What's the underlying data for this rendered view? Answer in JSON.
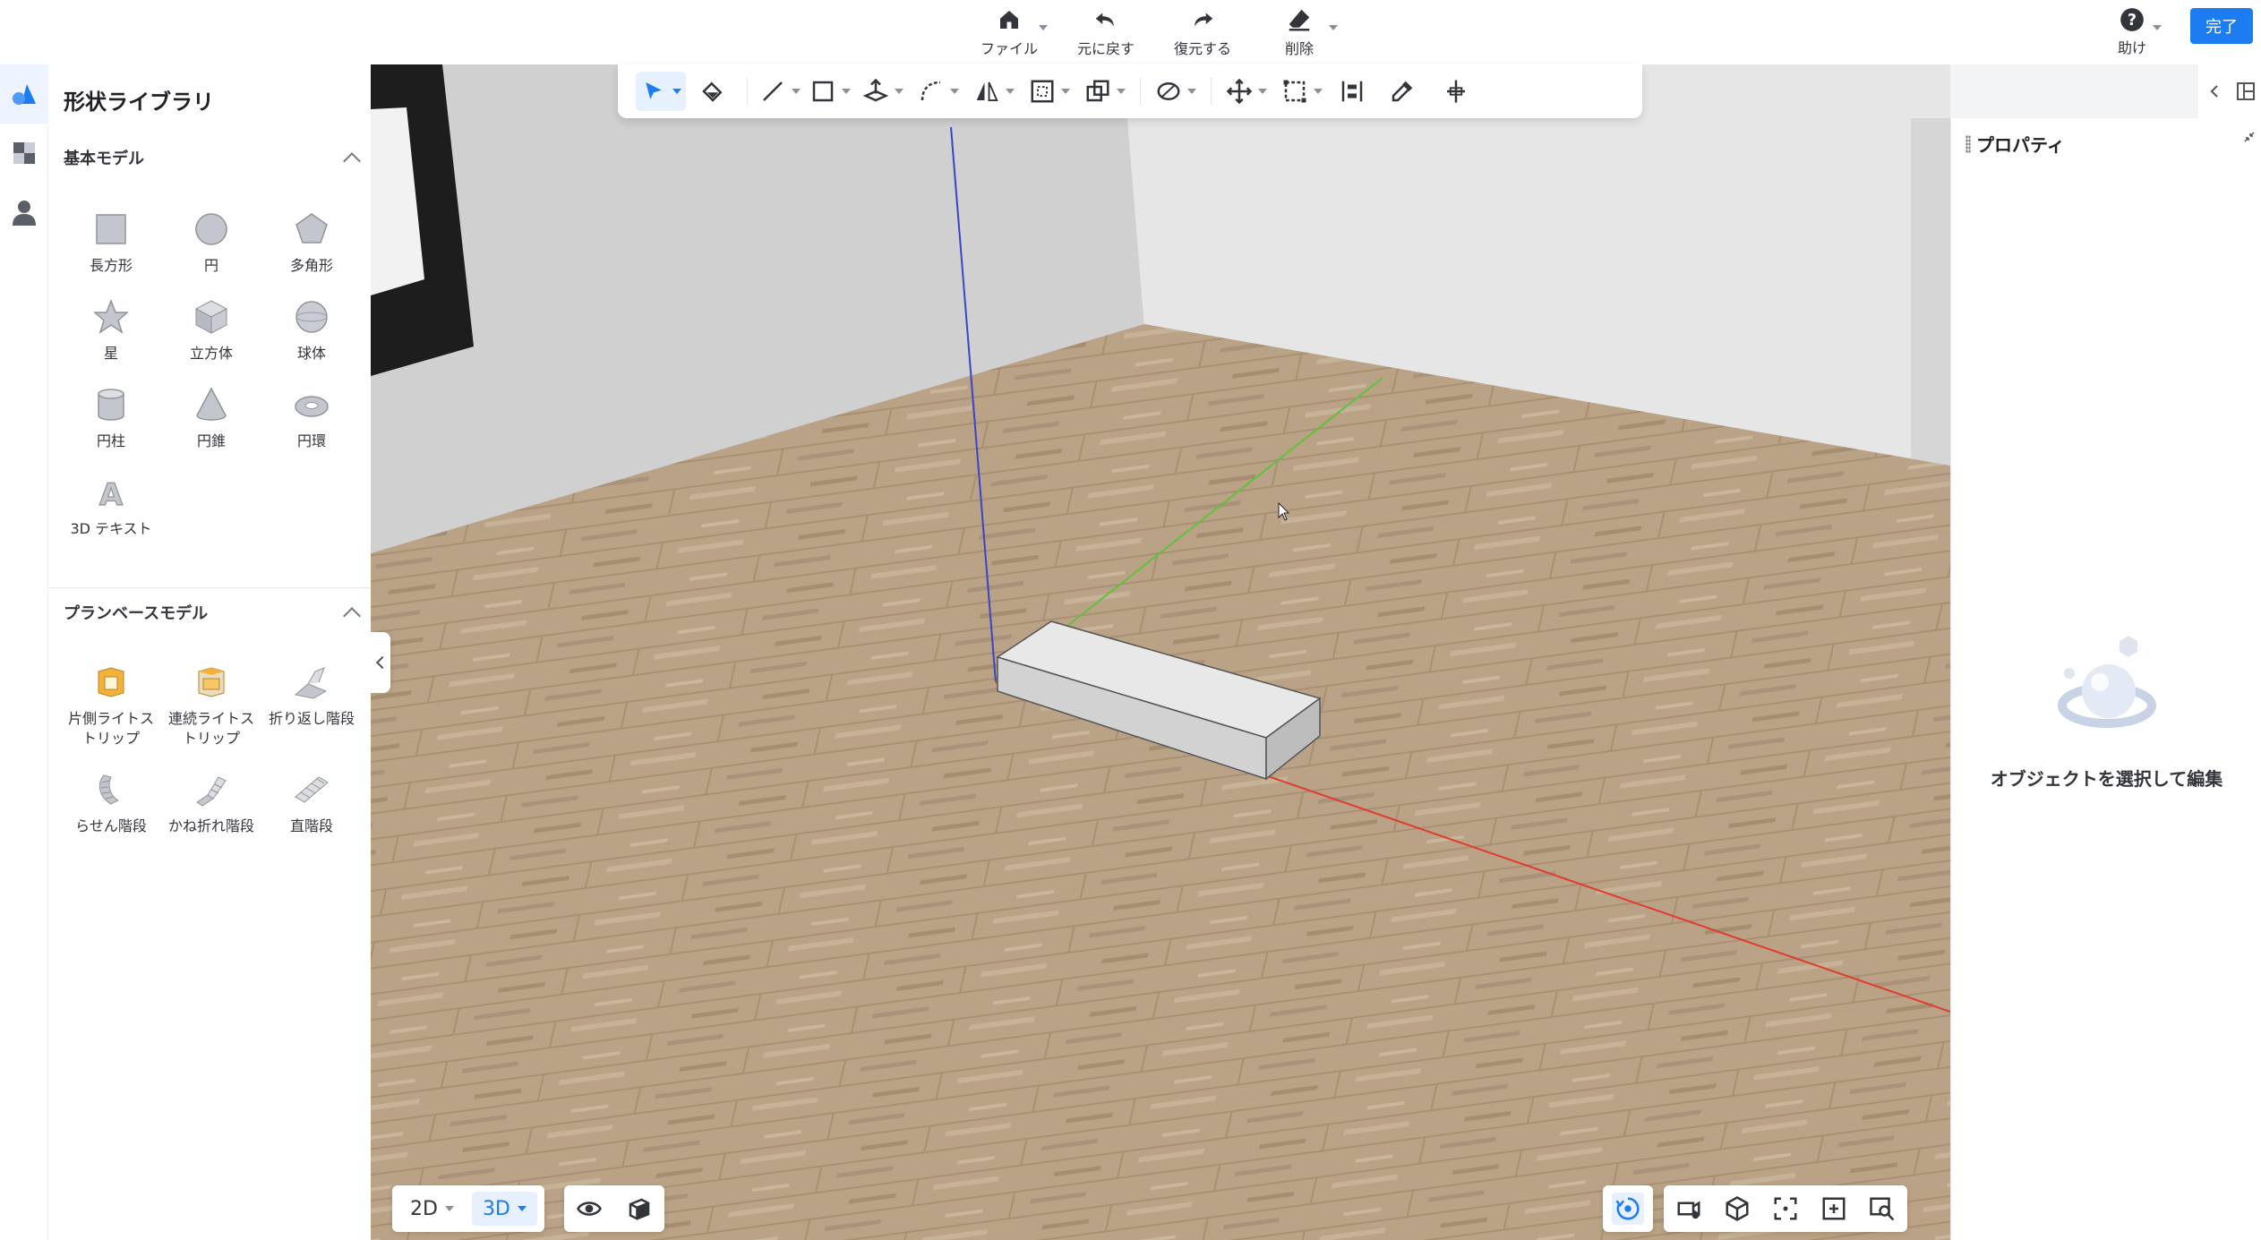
{
  "topbar": {
    "actions": [
      {
        "label": "ファイル",
        "icon": "home-icon",
        "dropdown": true
      },
      {
        "label": "元に戻す",
        "icon": "undo-icon",
        "dropdown": false
      },
      {
        "label": "復元する",
        "icon": "redo-icon",
        "dropdown": false
      },
      {
        "label": "削除",
        "icon": "eraser-icon",
        "dropdown": true
      }
    ],
    "help_label": "助け",
    "done_label": "完了"
  },
  "rail": {
    "items": [
      {
        "icon": "shapes-icon",
        "active": true
      },
      {
        "icon": "material-icon",
        "active": false
      },
      {
        "icon": "user-icon",
        "active": false
      }
    ]
  },
  "library": {
    "title": "形状ライブラリ",
    "sections": [
      {
        "title": "基本モデル",
        "items": [
          {
            "label": "長方形",
            "icon": "rectangle-icon"
          },
          {
            "label": "円",
            "icon": "circle-icon"
          },
          {
            "label": "多角形",
            "icon": "polygon-icon"
          },
          {
            "label": "星",
            "icon": "star-icon"
          },
          {
            "label": "立方体",
            "icon": "cube-icon"
          },
          {
            "label": "球体",
            "icon": "sphere-icon"
          },
          {
            "label": "円柱",
            "icon": "cylinder-icon"
          },
          {
            "label": "円錐",
            "icon": "cone-icon"
          },
          {
            "label": "円環",
            "icon": "torus-icon"
          },
          {
            "label": "3D テキスト",
            "icon": "text-3d-icon"
          }
        ]
      },
      {
        "title": "プランベースモデル",
        "items": [
          {
            "label": "片側ライトストリップ",
            "icon": "light-strip-single-icon"
          },
          {
            "label": "連続ライトストリップ",
            "icon": "light-strip-continuous-icon"
          },
          {
            "label": "折り返し階段",
            "icon": "switchback-stairs-icon"
          },
          {
            "label": "らせん階段",
            "icon": "spiral-stairs-icon"
          },
          {
            "label": "かね折れ階段",
            "icon": "l-stairs-icon"
          },
          {
            "label": "直階段",
            "icon": "straight-stairs-icon"
          }
        ]
      }
    ]
  },
  "toolbar": {
    "tools": [
      "select-icon",
      "paint-bucket-icon",
      "line-icon",
      "rectangle-tool-icon",
      "push-pull-icon",
      "curve-icon",
      "mirror-icon",
      "offset-icon",
      "combine-icon",
      "material-brush-icon",
      "move-icon",
      "scale-icon",
      "align-icon",
      "eyedropper-icon",
      "axis-icon"
    ]
  },
  "properties": {
    "title": "プロパティ",
    "empty_text": "オブジェクトを選択して編集"
  },
  "view": {
    "modes": [
      {
        "label": "2D",
        "active": false
      },
      {
        "label": "3D",
        "active": true
      }
    ]
  },
  "colors": {
    "accent": "#1c7cf2",
    "floor": "#b9a285",
    "wall": "#e5e5e5",
    "axis_x": "#e23b2e",
    "axis_y": "#5fc23a",
    "axis_z": "#3845c8"
  }
}
